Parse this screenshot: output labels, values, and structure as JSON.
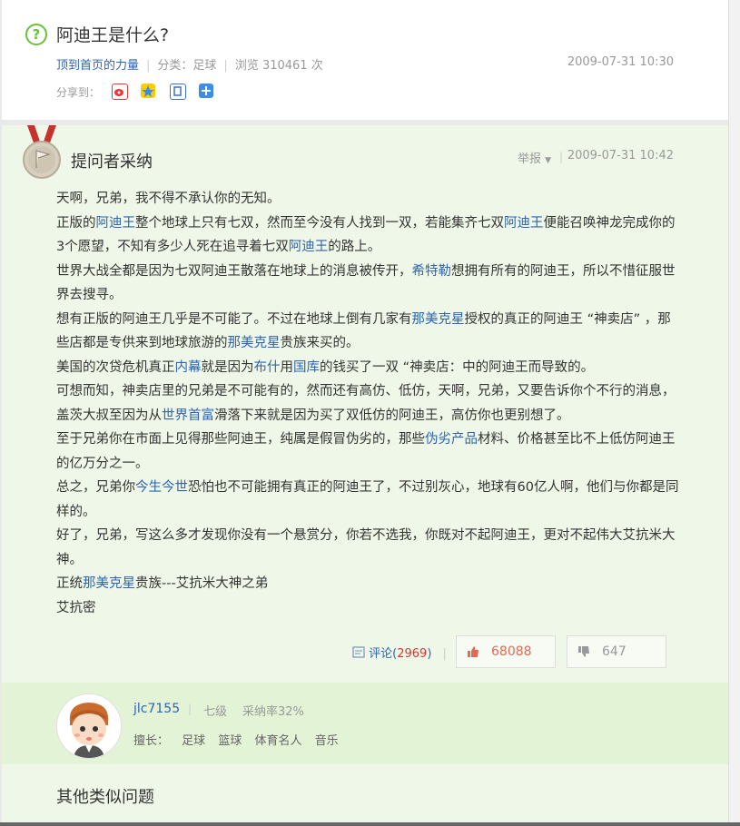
{
  "question": {
    "title": "阿迪王是什么?",
    "source_link": "顶到首页的力量",
    "category_label": "分类：足球",
    "views_label": "浏览 310461 次",
    "time": "2009-07-31 10:30",
    "share_label": "分享到："
  },
  "answer": {
    "header": "提问者采纳",
    "report_label": "举报",
    "time": "2009-07-31 10:42",
    "paragraphs": [
      [
        {
          "t": "天啊，兄弟，我不得不承认你的无知。"
        }
      ],
      [
        {
          "t": "正版的"
        },
        {
          "t": "阿迪王",
          "link": true
        },
        {
          "t": "整个地球上只有七双，然而至今没有人找到一双，若能集齐七双"
        },
        {
          "t": "阿迪王",
          "link": true
        },
        {
          "t": "便能召唤神龙完成你的3个愿望，不知有多少人死在追寻着七双"
        },
        {
          "t": "阿迪王",
          "link": true
        },
        {
          "t": "的路上。"
        }
      ],
      [
        {
          "t": "世界大战全都是因为七双阿迪王散落在地球上的消息被传开，"
        },
        {
          "t": "希特勒",
          "link": true
        },
        {
          "t": "想拥有所有的阿迪王，所以不惜征服世界去搜寻。"
        }
      ],
      [
        {
          "t": "想有正版的阿迪王几乎是不可能了。不过在地球上倒有几家有"
        },
        {
          "t": "那美克星",
          "link": true
        },
        {
          "t": "授权的真正的阿迪王 “神卖店” ，那些店都是专供来到地球旅游的"
        },
        {
          "t": "那美克星",
          "link": true
        },
        {
          "t": "贵族来买的。"
        }
      ],
      [
        {
          "t": "美国的次贷危机真正"
        },
        {
          "t": "内幕",
          "link": true
        },
        {
          "t": "就是因为"
        },
        {
          "t": "布什",
          "link": true
        },
        {
          "t": "用"
        },
        {
          "t": "国库",
          "link": true
        },
        {
          "t": "的钱买了一双 “神卖店：中的阿迪王而导致的。"
        }
      ],
      [
        {
          "t": "可想而知，神卖店里的兄弟是不可能有的，然而还有高仿、低仿，天啊，兄弟，又要告诉你个不行的消息，盖茨大叔至因为从"
        },
        {
          "t": "世界首富",
          "link": true
        },
        {
          "t": "滑落下来就是因为买了双低仿的阿迪王，高仿你也更别想了。"
        }
      ],
      [
        {
          "t": "至于兄弟你在市面上见得那些阿迪王，纯属是假冒伪劣的，那些"
        },
        {
          "t": "伪劣产品",
          "link": true
        },
        {
          "t": "材料、价格甚至比不上低仿阿迪王的亿万分之一。"
        }
      ],
      [
        {
          "t": "总之，兄弟你"
        },
        {
          "t": "今生今世",
          "link": true
        },
        {
          "t": "恐怕也不可能拥有真正的阿迪王了，不过别灰心，地球有60亿人啊，他们与你都是同样的。"
        }
      ],
      [
        {
          "t": "好了，兄弟，写这么多才发现你没有一个悬赏分，你若不选我，你既对不起阿迪王，更对不起伟大艾抗米大神。"
        }
      ],
      [
        {
          "t": "正统"
        },
        {
          "t": "那美克星",
          "link": true
        },
        {
          "t": "贵族---艾抗米大神之弟"
        }
      ],
      [
        {
          "t": "艾抗密"
        }
      ]
    ],
    "comment_label": "评论(",
    "comment_count": "2969",
    "comment_close": ")",
    "upvotes": "68088",
    "downvotes": "647"
  },
  "author": {
    "name": "jlc7155",
    "level": "七级",
    "rate": "采纳率32%",
    "skills_label": "擅长：",
    "skills": [
      "足球",
      "篮球",
      "体育名人",
      "音乐"
    ]
  },
  "similar_title": "其他类似问题",
  "colors": {
    "link": "#2d64b3",
    "accent_green": "#6cbf3a",
    "answer_bg": "#eff8e8",
    "up_red": "#e26a55"
  }
}
